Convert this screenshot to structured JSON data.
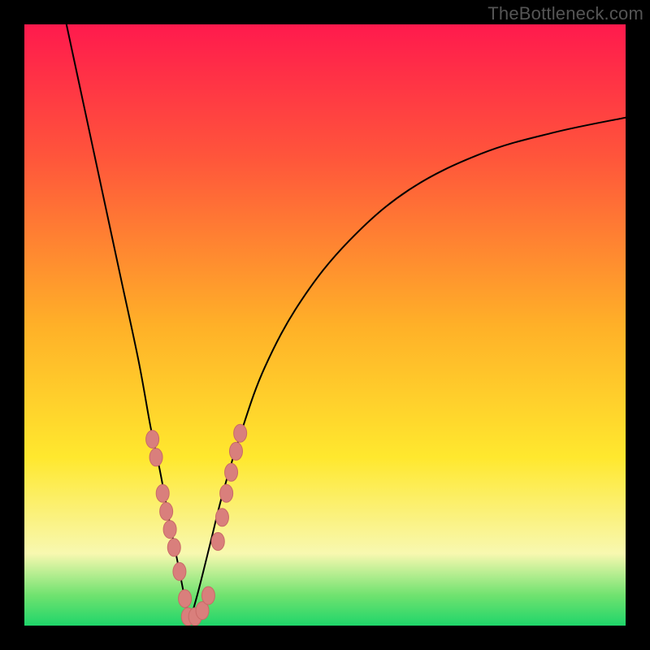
{
  "watermark": "TheBottleneck.com",
  "colors": {
    "black": "#000000",
    "curve": "#000000",
    "marker_fill": "#d97f7c",
    "marker_stroke": "#c96a67",
    "grad_top": "#ff1a4d",
    "grad_upper": "#ff553b",
    "grad_mid": "#ffb028",
    "grad_yellow": "#ffe82e",
    "grad_pale": "#f8f8b0",
    "grad_green1": "#6fe26f",
    "grad_green2": "#1fd56a"
  },
  "chart_data": {
    "type": "line",
    "title": "",
    "xlabel": "",
    "ylabel": "",
    "xlim": [
      0,
      100
    ],
    "ylim": [
      0,
      100
    ],
    "series": [
      {
        "name": "left-branch",
        "x": [
          7,
          10,
          13,
          16,
          19,
          21,
          22.5,
          24,
          25.2,
          26,
          26.8,
          27.6
        ],
        "y": [
          100,
          86,
          72,
          58,
          44,
          33,
          26,
          18,
          12,
          8,
          4,
          1
        ]
      },
      {
        "name": "right-branch",
        "x": [
          27.6,
          29,
          31,
          33,
          36,
          40,
          46,
          54,
          64,
          76,
          88,
          100
        ],
        "y": [
          1,
          6,
          14,
          22,
          32,
          43,
          54,
          64,
          72.5,
          78.5,
          82,
          84.5
        ]
      }
    ],
    "marker_clusters": [
      {
        "name": "left-cluster",
        "points": [
          {
            "x": 21.3,
            "y": 31
          },
          {
            "x": 21.9,
            "y": 28
          },
          {
            "x": 23.0,
            "y": 22
          },
          {
            "x": 23.6,
            "y": 19
          },
          {
            "x": 24.2,
            "y": 16
          },
          {
            "x": 24.9,
            "y": 13
          },
          {
            "x": 25.8,
            "y": 9
          },
          {
            "x": 26.7,
            "y": 4.5
          }
        ]
      },
      {
        "name": "bottom-cluster",
        "points": [
          {
            "x": 27.2,
            "y": 1.5
          },
          {
            "x": 28.4,
            "y": 1.5
          },
          {
            "x": 29.6,
            "y": 2.5
          },
          {
            "x": 30.6,
            "y": 5
          }
        ]
      },
      {
        "name": "right-cluster",
        "points": [
          {
            "x": 32.2,
            "y": 14
          },
          {
            "x": 32.9,
            "y": 18
          },
          {
            "x": 33.6,
            "y": 22
          },
          {
            "x": 34.4,
            "y": 25.5
          },
          {
            "x": 35.2,
            "y": 29
          },
          {
            "x": 35.9,
            "y": 32
          }
        ]
      }
    ],
    "gradient_stops": [
      {
        "pct": 0,
        "key": "grad_top"
      },
      {
        "pct": 22,
        "key": "grad_upper"
      },
      {
        "pct": 50,
        "key": "grad_mid"
      },
      {
        "pct": 72,
        "key": "grad_yellow"
      },
      {
        "pct": 88,
        "key": "grad_pale"
      },
      {
        "pct": 95,
        "key": "grad_green1"
      },
      {
        "pct": 100,
        "key": "grad_green2"
      }
    ]
  }
}
